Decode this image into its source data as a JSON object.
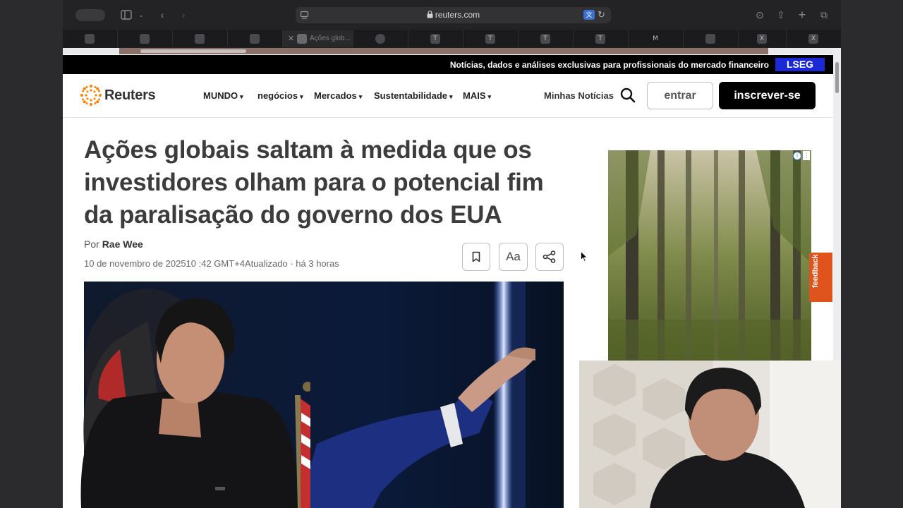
{
  "browser": {
    "url": "reuters.com",
    "active_tab_title": "Ações glob...",
    "tab_favicons": [
      "T",
      "T",
      "T",
      "T",
      "M",
      "X",
      "X"
    ]
  },
  "banner": {
    "text": "Notícias, dados e análises exclusivas para profissionais do mercado financeiro",
    "brand": "LSEG",
    "brand_color": "#1a28d6"
  },
  "site": {
    "logo": "Reuters",
    "logo_color": "#ff8000"
  },
  "nav": {
    "items": [
      {
        "label": "MUNDO"
      },
      {
        "label": "negócios"
      },
      {
        "label": "Mercados"
      },
      {
        "label": "Sustentabilidade"
      },
      {
        "label": "MAIS"
      }
    ],
    "my_news": "Minhas Notícias",
    "login": "entrar",
    "signup": "inscrever-se"
  },
  "article": {
    "headline": "Ações globais saltam à medida que os investidores olham para o potencial fim da paralisação do governo dos EUA",
    "by_prefix": "Por",
    "author": "Rae Wee",
    "date": "10 de novembro de 202510 :42 GMT+4Atualizado · há 3 horas",
    "font_size_label": "Aa"
  },
  "side": {
    "feedback": "feedback",
    "feedback_color": "#e0531d"
  }
}
